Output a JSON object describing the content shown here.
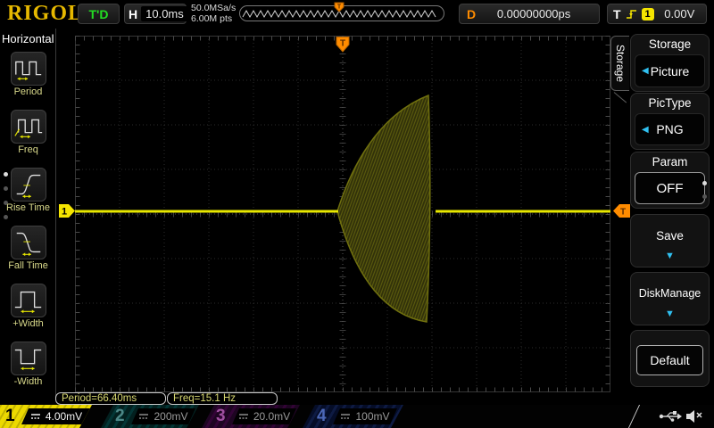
{
  "top_bar": {
    "logo": "RIGOL",
    "trigger_status": "T'D",
    "horizontal_label": "H",
    "timebase": "10.0ms",
    "sample_rate": "50.0MSa/s",
    "memory_depth": "6.00M pts",
    "delay_label": "D",
    "delay_value": "0.00000000ps",
    "trigger_label": "T",
    "trigger_source": "1",
    "trigger_level": "0.00V"
  },
  "left_menu": {
    "title": "Horizontal",
    "items": [
      {
        "label": "Period",
        "icon": "period-icon"
      },
      {
        "label": "Freq",
        "icon": "freq-icon"
      },
      {
        "label": "Rise Time",
        "icon": "rise-time-icon"
      },
      {
        "label": "Fall Time",
        "icon": "fall-time-icon"
      },
      {
        "label": "+Width",
        "icon": "plus-width-icon"
      },
      {
        "label": "-Width",
        "icon": "minus-width-icon"
      }
    ]
  },
  "right_menu": {
    "tab_label": "Storage",
    "items": [
      {
        "label": "Storage",
        "value": "Picture",
        "arrow": "left"
      },
      {
        "label": "PicType",
        "value": "PNG",
        "arrow": "left"
      },
      {
        "label": "Param",
        "value": "OFF"
      },
      {
        "label": "Save",
        "arrow": "down"
      },
      {
        "label": "DiskManage",
        "arrow": "down"
      },
      {
        "label": "Default"
      }
    ],
    "page_dots": 2
  },
  "measurements": {
    "period": "Period=66.40ms",
    "frequency": "Freq=15.1 Hz"
  },
  "channels": [
    {
      "number": "1",
      "scale": "4.00mV",
      "coupling": "dc-coupling-icon",
      "active": true
    },
    {
      "number": "2",
      "scale": "200mV",
      "coupling": "dc-coupling-icon",
      "active": false
    },
    {
      "number": "3",
      "scale": "20.0mV",
      "coupling": "dc-coupling-icon",
      "active": false
    },
    {
      "number": "4",
      "scale": "100mV",
      "coupling": "dc-coupling-icon",
      "active": false
    }
  ],
  "waveform": {
    "type": "line",
    "channel": 1,
    "description": "Flat baseline with a dense amplitude-modulated burst envelope just right of screen center; trigger point marker at horizontal center, trigger level at baseline.",
    "trigger_marker": "T",
    "channel_marker": "1"
  },
  "status_icons": [
    "usb-icon",
    "speaker-muted-icon"
  ],
  "colors": {
    "ch1": "#f5e500",
    "ch2": "#00b0b0",
    "ch3": "#b000b0",
    "ch4": "#4060c0",
    "trigger_orange": "#ff8c00",
    "accent_cyan": "#30c0f0",
    "status_green": "#22dd22",
    "logo_gold": "#e6b800",
    "trace_yellow": "#e8e800"
  }
}
